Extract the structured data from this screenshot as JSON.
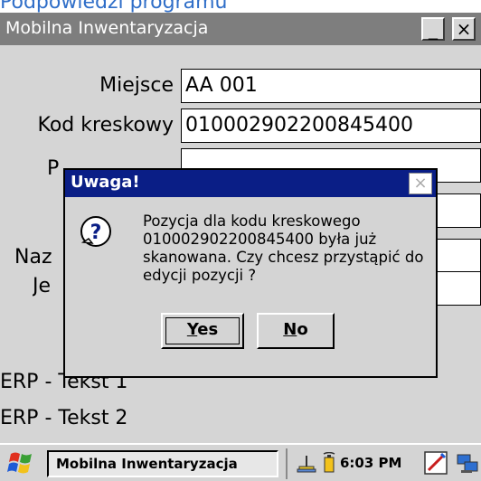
{
  "caption": "Podpowiedzi programu",
  "window": {
    "title": "Mobilna Inwentaryzacja",
    "min_label": "_",
    "close_label": "×"
  },
  "form": {
    "miejsce_label": "Miejsce",
    "miejsce_value": "AA 001",
    "kod_label": "Kod kreskowy",
    "kod_value": "010002902200845400",
    "hidden_label_1": "P",
    "hidden_label_2": "Naz",
    "hidden_label_3": "Je"
  },
  "erp": {
    "line1": "ERP - Tekst 1",
    "line2": "ERP - Tekst 2"
  },
  "dialog": {
    "title": "Uwaga!",
    "close_label": "×",
    "message": "Pozycja dla kodu kreskowego 010002902200845400 była już skanowana. Czy chcesz przystąpić do edycji pozycji ?",
    "yes_hotkey": "Y",
    "yes_rest": "es",
    "no_hotkey": "N",
    "no_rest": "o"
  },
  "taskbar": {
    "task_label": "Mobilna Inwentaryzacja",
    "clock": "6:03 PM"
  }
}
